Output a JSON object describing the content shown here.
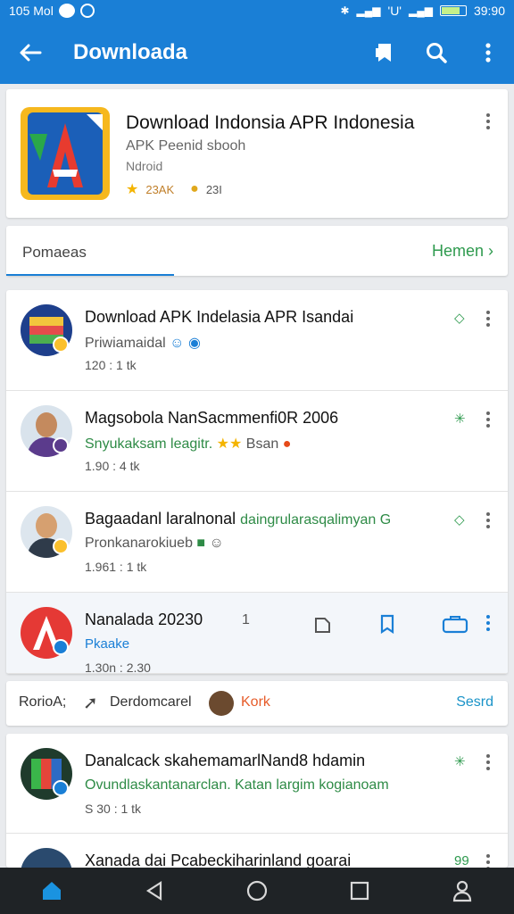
{
  "status": {
    "left": "105 Mol",
    "right": "39:90",
    "signal": "'U'"
  },
  "appbar": {
    "title": "Downloada",
    "back_icon": "arrow-left-icon",
    "actions": [
      "bookmark-icon",
      "search-icon",
      "more-vert-icon"
    ]
  },
  "hero": {
    "title": "Download Indonsia APR Indonesia",
    "subtitle": "APK Peenid sbooh",
    "category": "Ndroid",
    "rating_text": "23AK",
    "downloads_text": "23I"
  },
  "tabs": {
    "active": "Pomaeas",
    "more": "Hemen"
  },
  "list": [
    {
      "name": "Download APK Indelasia APR Isandai",
      "sub": "Priwiamaidal",
      "meta": "120 : 1 tk",
      "tag": "◇",
      "sub_green": false
    },
    {
      "name": "Magsobola NanSacmmenfi0R 2006",
      "sub": "Snyukaksam leagitr.",
      "sub_extra": "Bsan",
      "meta": "1.90 : 4 tk",
      "tag": "✳",
      "sub_green": true
    },
    {
      "name": "Bagaadanl laralnonal",
      "name_extra": "daingrularasqalimyan G",
      "sub": "Pronkanarokiueb",
      "meta": "1.961 : 1 tk",
      "tag": "◇",
      "sub_green": false
    },
    {
      "name": "Nanalada 20230",
      "name_extra": "1",
      "sub": "Pkaake",
      "meta": "1.30n : 2.30",
      "tag": "",
      "sub_green": false
    }
  ],
  "filters": {
    "label": "RorioA;",
    "item1": "Derdomcarel",
    "item2": "Kork",
    "action": "Sesrd"
  },
  "bottom_list": [
    {
      "name": "Danalcack skahemamarlNand8 hdamin",
      "sub": "Ovundlaskantanarclan. Katan largim kogianoam",
      "meta": "S 30 : 1 tk",
      "tag": "✳"
    },
    {
      "name": "Xanada dai Pcabeckiharinland goarai",
      "tag": "99"
    }
  ],
  "colors": {
    "primary": "#1a7fd6",
    "accent_green": "#2e9a4e",
    "nav_bg": "#1f2326"
  },
  "navbar": [
    "home-icon",
    "back-triangle-icon",
    "home-circle-icon",
    "recents-square-icon",
    "profile-icon"
  ]
}
